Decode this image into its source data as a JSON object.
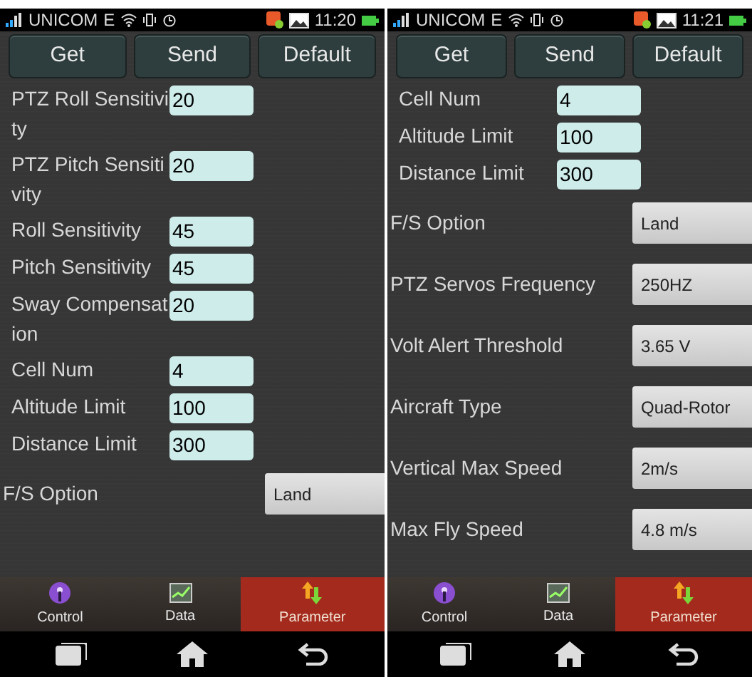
{
  "phones": [
    {
      "status": {
        "carrier": "UNICOM",
        "network": "E",
        "time": "11:20"
      },
      "buttons": [
        "Get",
        "Send",
        "Default"
      ],
      "params": [
        {
          "kind": "input",
          "label": "PTZ Roll Sensitivity",
          "value": "20"
        },
        {
          "kind": "input",
          "label": "PTZ Pitch Sensitivity",
          "value": "20"
        },
        {
          "kind": "input",
          "label": "Roll Sensitivity",
          "value": "45"
        },
        {
          "kind": "input",
          "label": "Pitch Sensitivity",
          "value": "45"
        },
        {
          "kind": "input",
          "label": "Sway Compensation",
          "value": "20"
        },
        {
          "kind": "input",
          "label": "Cell Num",
          "value": "4"
        },
        {
          "kind": "input",
          "label": "Altitude Limit",
          "value": "100"
        },
        {
          "kind": "input",
          "label": "Distance Limit",
          "value": "300"
        },
        {
          "kind": "select",
          "label": "F/S Option",
          "value": "Land"
        }
      ],
      "tabs": [
        {
          "label": "Control",
          "selected": false
        },
        {
          "label": "Data",
          "selected": false
        },
        {
          "label": "Parameter",
          "selected": true
        }
      ]
    },
    {
      "status": {
        "carrier": "UNICOM",
        "network": "E",
        "time": "11:21"
      },
      "buttons": [
        "Get",
        "Send",
        "Default"
      ],
      "params": [
        {
          "kind": "input",
          "label": "Cell Num",
          "value": "4"
        },
        {
          "kind": "input",
          "label": "Altitude Limit",
          "value": "100"
        },
        {
          "kind": "input",
          "label": "Distance Limit",
          "value": "300"
        },
        {
          "kind": "select",
          "label": "F/S Option",
          "value": "Land"
        },
        {
          "kind": "select",
          "label": "PTZ Servos Frequency",
          "value": "250HZ"
        },
        {
          "kind": "select",
          "label": "Volt Alert Threshold",
          "value": "3.65 V"
        },
        {
          "kind": "select",
          "label": "Aircraft Type",
          "value": "Quad-Rotor"
        },
        {
          "kind": "select",
          "label": "Vertical Max Speed",
          "value": "2m/s"
        },
        {
          "kind": "select",
          "label": "Max Fly Speed",
          "value": "4.8 m/s"
        }
      ],
      "tabs": [
        {
          "label": "Control",
          "selected": false
        },
        {
          "label": "Data",
          "selected": false
        },
        {
          "label": "Parameter",
          "selected": true
        }
      ]
    }
  ]
}
